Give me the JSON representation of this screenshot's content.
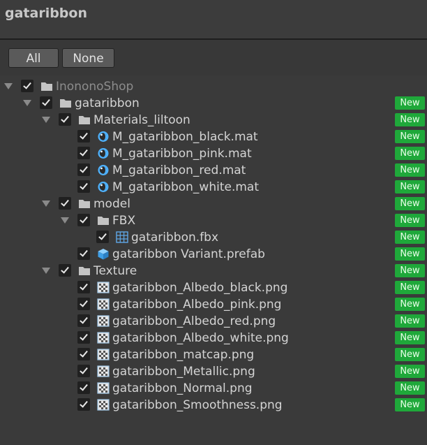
{
  "header": {
    "title": "gataribbon"
  },
  "buttons": {
    "all": "All",
    "none": "None"
  },
  "badge_label": "New",
  "tree": [
    {
      "label": "InononoShop",
      "depth": 0,
      "expandable": true,
      "icon": "folder-icon",
      "checked": true,
      "new": false,
      "dim": true
    },
    {
      "label": "gataribbon",
      "depth": 1,
      "expandable": true,
      "icon": "folder-icon",
      "checked": true,
      "new": true
    },
    {
      "label": "Materials_liltoon",
      "depth": 2,
      "expandable": true,
      "icon": "folder-icon",
      "checked": true,
      "new": true
    },
    {
      "label": "M_gataribbon_black.mat",
      "depth": 3,
      "expandable": false,
      "icon": "material-icon",
      "checked": true,
      "new": true
    },
    {
      "label": "M_gataribbon_pink.mat",
      "depth": 3,
      "expandable": false,
      "icon": "material-icon",
      "checked": true,
      "new": true
    },
    {
      "label": "M_gataribbon_red.mat",
      "depth": 3,
      "expandable": false,
      "icon": "material-icon",
      "checked": true,
      "new": true
    },
    {
      "label": "M_gataribbon_white.mat",
      "depth": 3,
      "expandable": false,
      "icon": "material-icon",
      "checked": true,
      "new": true
    },
    {
      "label": "model",
      "depth": 2,
      "expandable": true,
      "icon": "folder-icon",
      "checked": true,
      "new": true
    },
    {
      "label": "FBX",
      "depth": 3,
      "expandable": true,
      "icon": "folder-icon",
      "checked": true,
      "new": true
    },
    {
      "label": "gataribbon.fbx",
      "depth": 4,
      "expandable": false,
      "icon": "mesh-grid-icon",
      "checked": true,
      "new": true
    },
    {
      "label": "gataribbon Variant.prefab",
      "depth": 3,
      "expandable": false,
      "icon": "prefab-cube-icon",
      "checked": true,
      "new": true
    },
    {
      "label": "Texture",
      "depth": 2,
      "expandable": true,
      "icon": "folder-icon",
      "checked": true,
      "new": true
    },
    {
      "label": "gataribbon_Albedo_black.png",
      "depth": 3,
      "expandable": false,
      "icon": "texture-icon",
      "checked": true,
      "new": true
    },
    {
      "label": "gataribbon_Albedo_pink.png",
      "depth": 3,
      "expandable": false,
      "icon": "texture-icon",
      "checked": true,
      "new": true
    },
    {
      "label": "gataribbon_Albedo_red.png",
      "depth": 3,
      "expandable": false,
      "icon": "texture-icon",
      "checked": true,
      "new": true
    },
    {
      "label": "gataribbon_Albedo_white.png",
      "depth": 3,
      "expandable": false,
      "icon": "texture-icon",
      "checked": true,
      "new": true
    },
    {
      "label": "gataribbon_matcap.png",
      "depth": 3,
      "expandable": false,
      "icon": "texture-icon",
      "checked": true,
      "new": true
    },
    {
      "label": "gataribbon_Metallic.png",
      "depth": 3,
      "expandable": false,
      "icon": "texture-icon",
      "checked": true,
      "new": true
    },
    {
      "label": "gataribbon_Normal.png",
      "depth": 3,
      "expandable": false,
      "icon": "texture-icon",
      "checked": true,
      "new": true
    },
    {
      "label": "gataribbon_Smoothness.png",
      "depth": 3,
      "expandable": false,
      "icon": "texture-icon",
      "checked": true,
      "new": true
    }
  ],
  "colors": {
    "background": "#383838",
    "badge": "#1fa83a",
    "material_icon": "#4fb3ff"
  }
}
